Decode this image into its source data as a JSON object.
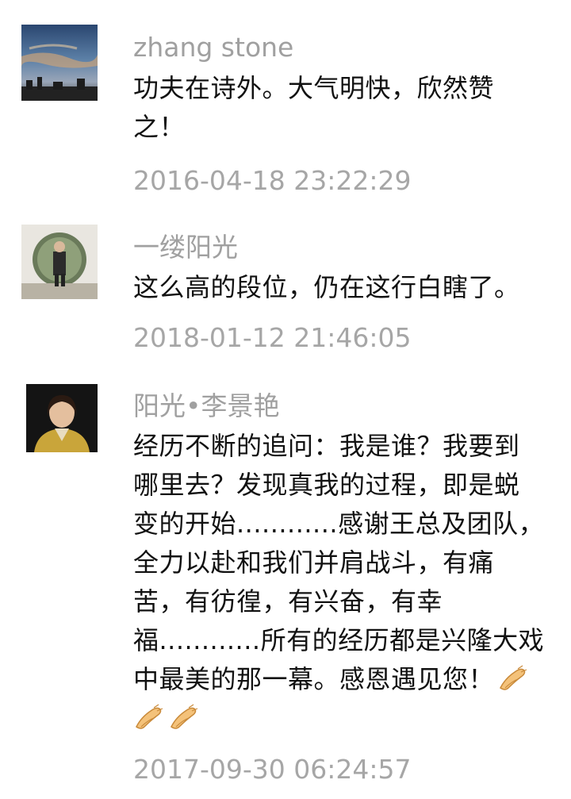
{
  "comments": [
    {
      "username": "zhang stone",
      "lines": [
        "功夫在诗外。大气明快，欣然赞",
        "之！"
      ],
      "timestamp": "2016-04-18 23:22:29",
      "avatar_icon": "sky-photo-avatar"
    },
    {
      "username": "一缕阳光",
      "lines": [
        "这么高的段位，仍在这行白瞎了。"
      ],
      "timestamp": "2018-01-12 21:46:05",
      "avatar_icon": "moon-gate-photo-avatar"
    },
    {
      "username": "阳光•李景艳",
      "lines": [
        "经历不断的追问：我是谁？我要到",
        "哪里去？发现真我的过程，即是蜕",
        "变的开始............感谢王总及团队，",
        "全力以赴和我们并肩战斗，有痛",
        "苦，有彷徨，有兴奋，有幸",
        "福............所有的经历都是兴隆大戏",
        "中最美的那一幕。感恩遇见您！"
      ],
      "timestamp": "2017-09-30 06:24:57",
      "avatar_icon": "portrait-photo-avatar",
      "emoji_icon": "pray-hands-emoji",
      "emoji_count_line7": 1,
      "emoji_count_line8": 2
    }
  ],
  "colors": {
    "username": "#a0a0a0",
    "content": "#111111",
    "timestamp": "#a6a6a6",
    "background": "#ffffff"
  }
}
